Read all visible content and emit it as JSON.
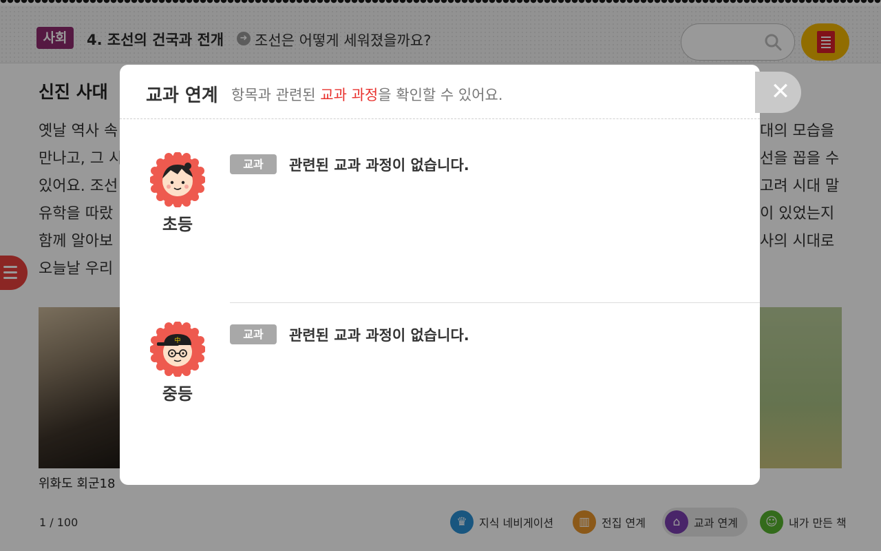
{
  "header": {
    "subject": "사회",
    "chapter": "4. 조선의 건국과 전개",
    "lesson": "조선은 어떻게 세워졌을까요?",
    "search_placeholder": ""
  },
  "content": {
    "title": "신진 사대",
    "lines": [
      "옛날 역사 속",
      "만나고, 그 시",
      "있어요. 조선",
      "유학을 따랐",
      "함께 알아보",
      "오늘날 우리"
    ],
    "lines_right": [
      "대의 모습을",
      "선을 꼽을 수",
      "고려 시대 말",
      "이 있었는지",
      "사의 시대로"
    ],
    "captions": [
      "위화도 회군18"
    ]
  },
  "footer": {
    "page": "1 / 100",
    "tabs": [
      {
        "label": "지식 네비게이션",
        "icon": "crown-icon",
        "color": "#2a8fd4"
      },
      {
        "label": "전집 연계",
        "icon": "books-icon",
        "color": "#e8942a"
      },
      {
        "label": "교과 연계",
        "icon": "school-icon",
        "color": "#7a3fb0"
      },
      {
        "label": "내가 만든 책",
        "icon": "smile-icon",
        "color": "#55b22e"
      }
    ]
  },
  "modal": {
    "title": "교과 연계",
    "subtitle_before": "항목과 관련된 ",
    "subtitle_highlight": "교과 과정",
    "subtitle_after": "을 확인할 수 있어요.",
    "rows": [
      {
        "level": "초등",
        "badge": "교과",
        "message": "관련된 교과 과정이 없습니다."
      },
      {
        "level": "중등",
        "badge": "교과",
        "message": "관련된 교과 과정이 없습니다."
      }
    ],
    "close_symbol": "✕",
    "middle_school_cap_glyph": "中"
  }
}
